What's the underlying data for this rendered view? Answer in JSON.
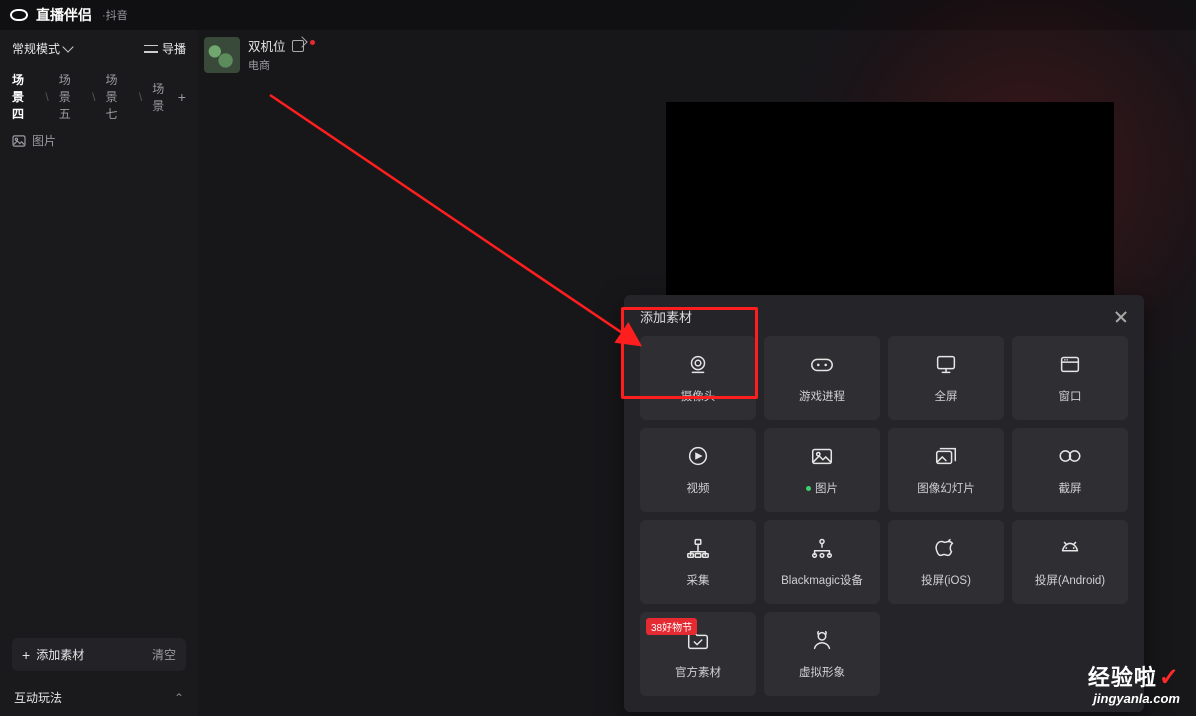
{
  "header": {
    "logo_text": "直播伴侣",
    "logo_sub": "·抖音"
  },
  "sidebar": {
    "mode_label": "常规模式",
    "guide_label": "导播",
    "tabs": {
      "active": "场景四",
      "items": [
        "场景五",
        "场景七",
        "场景"
      ]
    },
    "scene_item_label": "图片",
    "add_source_label": "添加素材",
    "clear_label": "清空",
    "interact_label": "互动玩法"
  },
  "source_chip": {
    "title": "双机位",
    "sub": "电商"
  },
  "modal": {
    "title": "添加素材",
    "cards": [
      {
        "id": "camera",
        "label": "摄像头"
      },
      {
        "id": "game",
        "label": "游戏进程"
      },
      {
        "id": "fullscreen",
        "label": "全屏"
      },
      {
        "id": "window",
        "label": "窗口"
      },
      {
        "id": "video",
        "label": "视频"
      },
      {
        "id": "image",
        "label": "图片",
        "dot": true
      },
      {
        "id": "slideshow",
        "label": "图像幻灯片"
      },
      {
        "id": "capture",
        "label": "截屏"
      },
      {
        "id": "collect",
        "label": "采集"
      },
      {
        "id": "blackmagic",
        "label": "Blackmagic设备"
      },
      {
        "id": "ios",
        "label": "投屏(iOS)"
      },
      {
        "id": "android",
        "label": "投屏(Android)"
      },
      {
        "id": "official",
        "label": "官方素材",
        "badge": "38好物节"
      },
      {
        "id": "avatar",
        "label": "虚拟形象"
      }
    ]
  },
  "watermark": {
    "top": "经验啦",
    "sub": "jingyanla.com"
  }
}
